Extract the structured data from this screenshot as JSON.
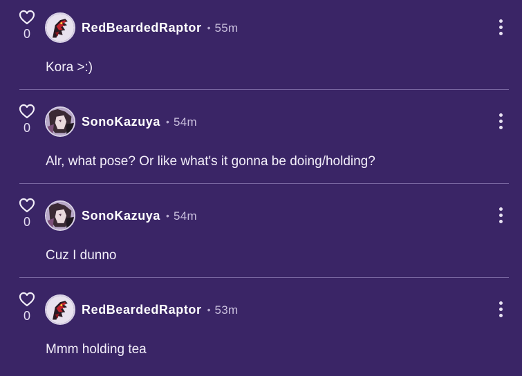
{
  "colors": {
    "background": "#3a2566",
    "divider": "#7866a0",
    "text": "#ffffff",
    "muted": "#c9bfdd"
  },
  "comments": [
    {
      "likes": "0",
      "username": "RedBeardedRaptor",
      "separator": "•",
      "time": "55m",
      "text": "Kora >:)",
      "avatar_icon": "red-dragon-avatar"
    },
    {
      "likes": "0",
      "username": "SonoKazuya",
      "separator": "•",
      "time": "54m",
      "text": "Alr, what pose? Or like what's it gonna be doing/holding?",
      "avatar_icon": "anime-character-avatar"
    },
    {
      "likes": "0",
      "username": "SonoKazuya",
      "separator": "•",
      "time": "54m",
      "text": "Cuz I dunno",
      "avatar_icon": "anime-character-avatar"
    },
    {
      "likes": "0",
      "username": "RedBeardedRaptor",
      "separator": "•",
      "time": "53m",
      "text": "Mmm holding tea",
      "avatar_icon": "red-dragon-avatar"
    }
  ]
}
